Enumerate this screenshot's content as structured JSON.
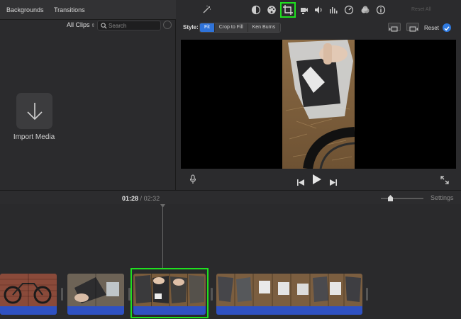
{
  "left_panel": {
    "tabs": [
      {
        "label": "Backgrounds"
      },
      {
        "label": "Transitions"
      }
    ],
    "filter": {
      "label": "All Clips"
    },
    "search": {
      "placeholder": "Search"
    },
    "import": {
      "label": "Import Media",
      "icon": "arrow-down-icon"
    }
  },
  "viewer": {
    "toolbar_icons": [
      "magic-wand-icon",
      "color-balance-icon",
      "color-palette-icon",
      "crop-icon",
      "stabilize-camera-icon",
      "volume-icon",
      "equalizer-icon",
      "speed-icon",
      "filter-icon",
      "info-icon"
    ],
    "active_tool": "crop-icon",
    "reset_all_label": "Reset All",
    "style": {
      "label": "Style:",
      "options": [
        "Fit",
        "Crop to Fill",
        "Ken Burns"
      ],
      "selected": "Fit"
    },
    "reset_label": "Reset"
  },
  "timeline": {
    "current_time": "01:28",
    "separator": "/",
    "total_time": "02:32",
    "settings_label": "Settings"
  },
  "colors": {
    "accent_blue": "#2f73d9",
    "highlight_green": "#1fe01f",
    "audio_blue": "#2f51c2"
  }
}
